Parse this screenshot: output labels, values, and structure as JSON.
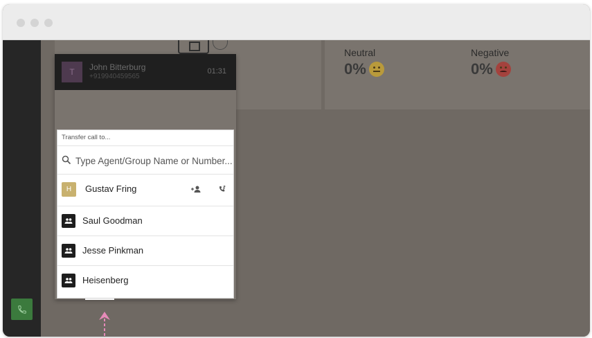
{
  "window": {
    "controls": [
      "close",
      "minimize",
      "maximize"
    ]
  },
  "stats": {
    "neutral": {
      "label": "Neutral",
      "value": "0%",
      "icon": "neutral-face-icon"
    },
    "negative": {
      "label": "Negative",
      "value": "0%",
      "icon": "sad-face-icon"
    }
  },
  "call": {
    "avatar_letter": "T",
    "caller_name": "John Bitterburg",
    "caller_number": "+919940459565",
    "timer": "01:31"
  },
  "transfer": {
    "title": "Transfer call to...",
    "search_placeholder": "Type Agent/Group Name or Number...",
    "agent": {
      "avatar_letter": "H",
      "name": "Gustav Fring",
      "actions": [
        "add-participant-icon",
        "transfer-call-icon"
      ]
    },
    "groups": [
      "Saul Goodman",
      "Jesse Pinkman",
      "Heisenberg"
    ]
  },
  "controls": [
    "notes-icon",
    "transfer-call-icon",
    "pause-icon",
    "mute-icon",
    "keypad-icon",
    "hangup-icon"
  ],
  "colors": {
    "accent_green": "#4caf50",
    "pointer": "#e58ab8",
    "agent_avatar": "#c8b16f"
  }
}
